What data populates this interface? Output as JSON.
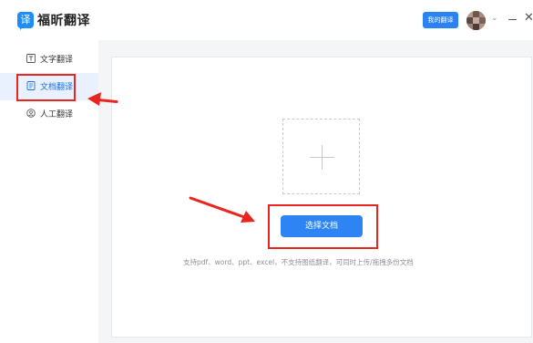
{
  "header": {
    "logo_char": "译",
    "app_title": "福昕翻译",
    "my_translate_label": "我的翻译",
    "chevron": "⌄",
    "close_glyph": "✕"
  },
  "sidebar": {
    "items": [
      {
        "label": "文字翻译",
        "icon": "text-translate-icon"
      },
      {
        "label": "文档翻译",
        "icon": "document-icon",
        "active": true
      },
      {
        "label": "人工翻译",
        "icon": "human-translate-icon"
      }
    ]
  },
  "main": {
    "choose_button_label": "选择文档",
    "hint_text": "支持pdf、word、ppt、excel，不支持图纸翻译，可同时上传/拖拽多份文档"
  },
  "colors": {
    "accent": "#2d84f2",
    "annotation_red": "#e8261f"
  }
}
